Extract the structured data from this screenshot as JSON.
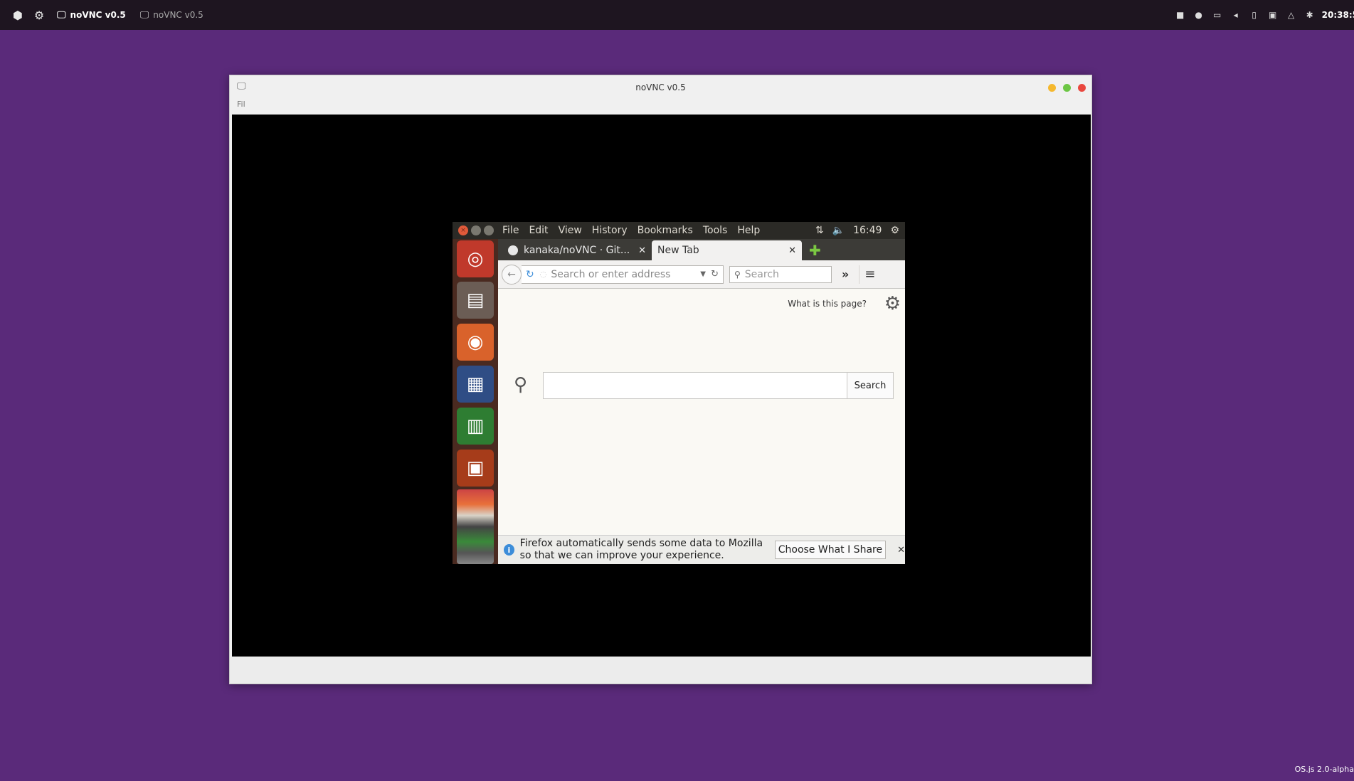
{
  "panel": {
    "windows": [
      {
        "label": "noVNC v0.5",
        "active": true
      },
      {
        "label": "noVNC v0.5",
        "active": false
      }
    ],
    "clock": "20:38:5",
    "tray_icons": [
      "network-icon",
      "user-icon",
      "display-icon",
      "volume-icon",
      "clipboard-icon",
      "window-icon",
      "wifi-icon",
      "settings-icon"
    ]
  },
  "window": {
    "title": "noVNC v0.5",
    "menu_label": "Fil"
  },
  "remote": {
    "menu": [
      "File",
      "Edit",
      "View",
      "History",
      "Bookmarks",
      "Tools",
      "Help"
    ],
    "time": "16:49",
    "tabs": [
      {
        "label": "kanaka/noVNC · Git..."
      },
      {
        "label": "New Tab"
      }
    ],
    "urlbar_placeholder": "Search or enter address",
    "searchbar_placeholder": "Search",
    "what_is_page": "What is this page?",
    "search_button": "Search",
    "notification": {
      "text": "Firefox automatically sends some data to Mozilla so that we can improve your experience.",
      "button": "Choose What I Share"
    }
  },
  "footer": {
    "version": "OS.js 2.0-alpha"
  }
}
